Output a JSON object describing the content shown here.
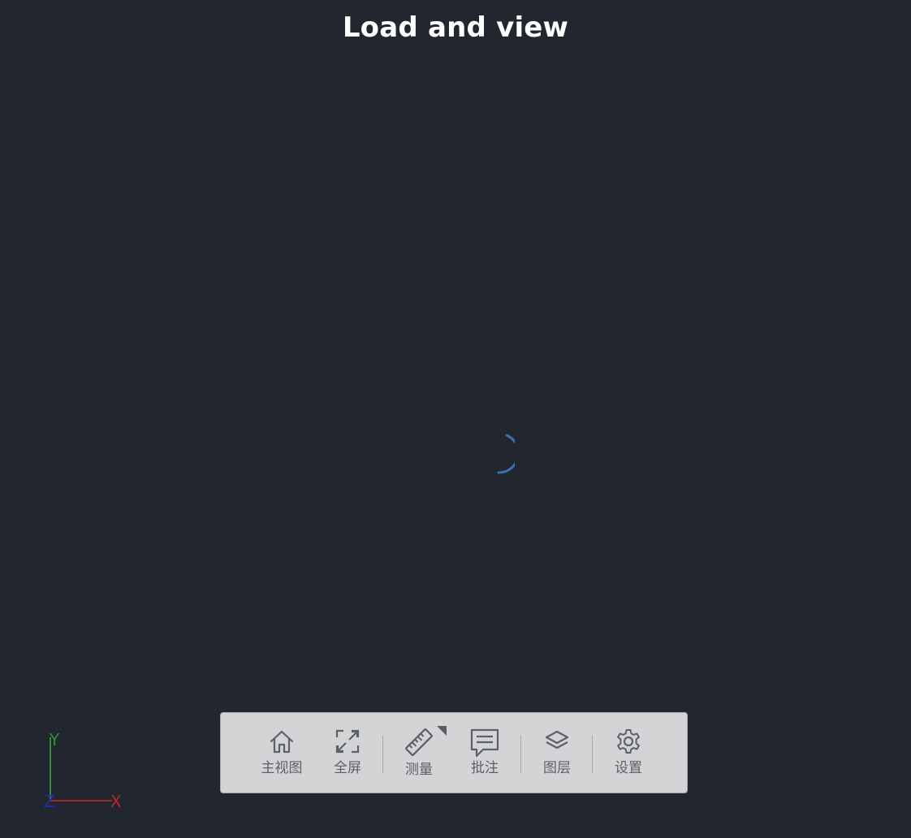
{
  "title": "Load and view",
  "loading": {
    "spinner_icon": "loading-spinner-icon",
    "color": "#3f6fb2"
  },
  "axes": {
    "x_label": "X",
    "y_label": "Y",
    "z_label": "Z",
    "x_color": "#b82a2a",
    "y_color": "#2e8f3c",
    "z_color": "#1f2fb5"
  },
  "toolbar": {
    "home": {
      "label": "主视图",
      "icon": "home-icon"
    },
    "fullscreen": {
      "label": "全屏",
      "icon": "fullscreen-icon"
    },
    "measure": {
      "label": "测量",
      "icon": "ruler-icon",
      "has_submenu": true
    },
    "annotate": {
      "label": "批注",
      "icon": "comment-icon"
    },
    "layers": {
      "label": "图层",
      "icon": "layers-icon"
    },
    "settings": {
      "label": "设置",
      "icon": "gear-icon"
    }
  }
}
